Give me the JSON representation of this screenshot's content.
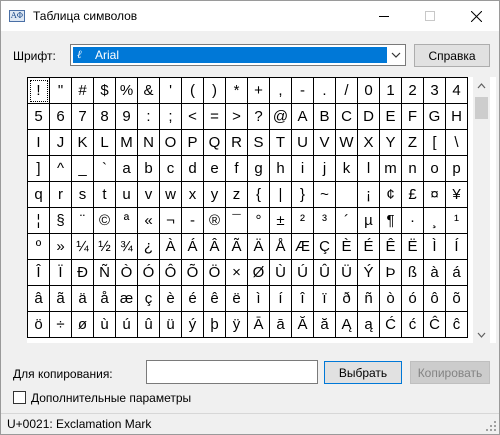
{
  "window": {
    "title": "Таблица символов",
    "app_icon": "ΑΦ"
  },
  "font": {
    "label": "Шрифт:",
    "selected": "Arial",
    "icon_glyph": "ℓ"
  },
  "buttons": {
    "help": "Справка",
    "select": "Выбрать",
    "copy": "Копировать"
  },
  "grid": {
    "selected_index": 0,
    "cells": [
      "!",
      "\"",
      "#",
      "$",
      "%",
      "&",
      "'",
      "(",
      ")",
      "*",
      "+",
      ",",
      "-",
      ".",
      "/",
      "0",
      "1",
      "2",
      "3",
      "4",
      "5",
      "6",
      "7",
      "8",
      "9",
      ":",
      ";",
      "<",
      "=",
      ">",
      "?",
      "@",
      "A",
      "B",
      "C",
      "D",
      "E",
      "F",
      "G",
      "H",
      "I",
      "J",
      "K",
      "L",
      "M",
      "N",
      "O",
      "P",
      "Q",
      "R",
      "S",
      "T",
      "U",
      "V",
      "W",
      "X",
      "Y",
      "Z",
      "[",
      "\\",
      "]",
      "^",
      "_",
      "`",
      "a",
      "b",
      "c",
      "d",
      "e",
      "f",
      "g",
      "h",
      "i",
      "j",
      "k",
      "l",
      "m",
      "n",
      "o",
      "p",
      "q",
      "r",
      "s",
      "t",
      "u",
      "v",
      "w",
      "x",
      "y",
      "z",
      "{",
      "|",
      "}",
      "~",
      " ",
      "¡",
      "¢",
      "£",
      "¤",
      "¥",
      "¦",
      "§",
      "¨",
      "©",
      "ª",
      "«",
      "¬",
      "-",
      "®",
      "¯",
      "°",
      "±",
      "²",
      "³",
      "´",
      "µ",
      "¶",
      "·",
      "¸",
      "¹",
      "º",
      "»",
      "¼",
      "½",
      "¾",
      "¿",
      "À",
      "Á",
      "Â",
      "Ã",
      "Ä",
      "Å",
      "Æ",
      "Ç",
      "È",
      "É",
      "Ê",
      "Ë",
      "Ì",
      "Í",
      "Î",
      "Ï",
      "Ð",
      "Ñ",
      "Ò",
      "Ó",
      "Ô",
      "Õ",
      "Ö",
      "×",
      "Ø",
      "Ù",
      "Ú",
      "Û",
      "Ü",
      "Ý",
      "Þ",
      "ß",
      "à",
      "á",
      "â",
      "ã",
      "ä",
      "å",
      "æ",
      "ç",
      "è",
      "é",
      "ê",
      "ë",
      "ì",
      "í",
      "î",
      "ï",
      "ð",
      "ñ",
      "ò",
      "ó",
      "ô",
      "õ",
      "ö",
      "÷",
      "ø",
      "ù",
      "ú",
      "û",
      "ü",
      "ý",
      "þ",
      "ÿ",
      "Ā",
      "ā",
      "Ă",
      "ă",
      "Ą",
      "ą",
      "Ć",
      "ć",
      "Ĉ",
      "ĉ"
    ]
  },
  "copy": {
    "label": "Для копирования:",
    "value": ""
  },
  "advanced": {
    "label": "Дополнительные параметры",
    "checked": false
  },
  "status": {
    "text": "U+0021: Exclamation Mark"
  },
  "colors": {
    "selection": "#0078d7",
    "window_bg": "#f0f0f0"
  }
}
